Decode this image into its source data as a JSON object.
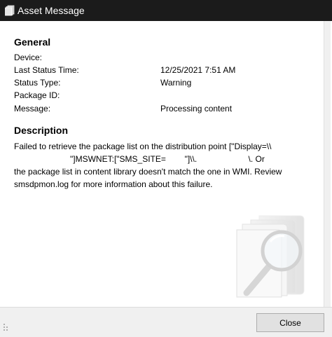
{
  "window": {
    "title": "Asset Message",
    "title_icon": "document-stack-icon"
  },
  "general": {
    "heading": "General",
    "rows": [
      {
        "label": "Device:",
        "value": ""
      },
      {
        "label": "Last Status Time:",
        "value": "12/25/2021 7:51 AM"
      },
      {
        "label": "Status Type:",
        "value": "Warning"
      },
      {
        "label": "Package ID:",
        "value": ""
      },
      {
        "label": "Message:",
        "value": "Processing content"
      }
    ]
  },
  "description": {
    "heading": "Description",
    "text": "Failed to retrieve the package list on the distribution point [\"Display=\\\\\n                        \"]MSWNET:[\"SMS_SITE=        \"]\\\\.                      \\. Or\nthe package list in content library doesn't match the one in WMI. Review\nsmsdpmon.log for more information about this failure."
  },
  "footer": {
    "close_label": "Close"
  },
  "icons": {
    "watermark": "magnifier-documents-icon",
    "resize_grip": "resize-grip-icon"
  }
}
